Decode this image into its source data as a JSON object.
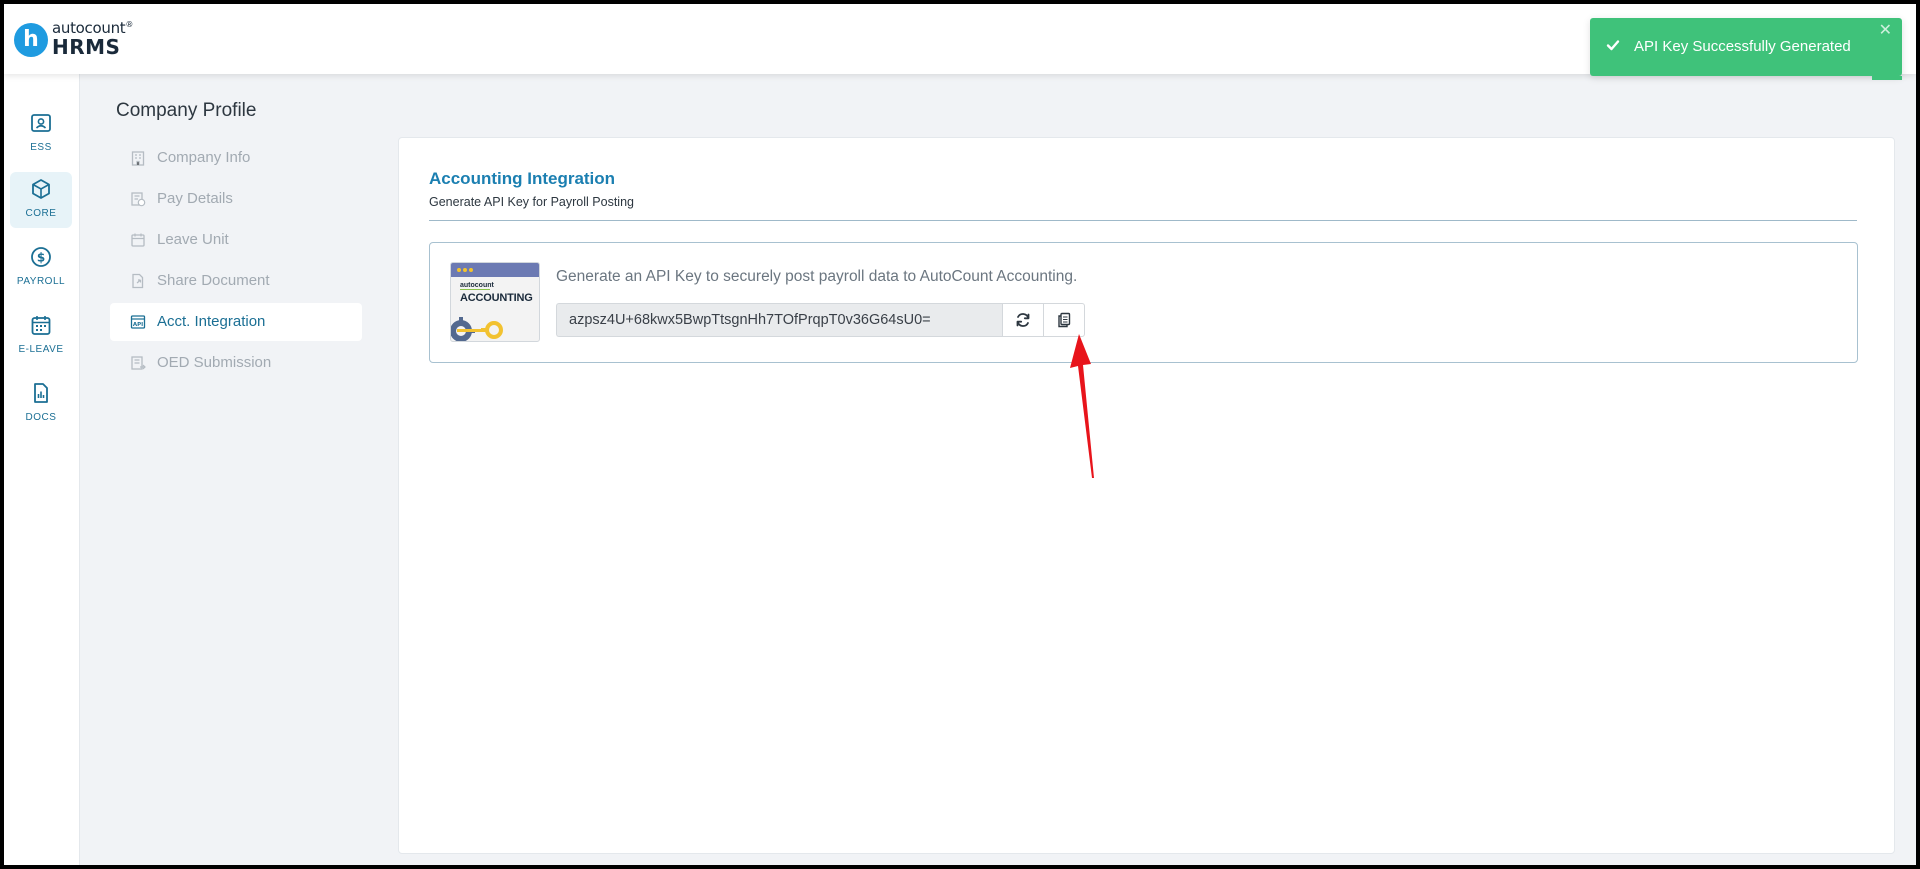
{
  "header": {
    "logo_letter": "h",
    "logo_brand": "autocount",
    "logo_brand_mark": "®",
    "logo_product": "HRMS"
  },
  "toast": {
    "message": "API Key Successfully Generated",
    "close": "✕",
    "color": "#3fc27a"
  },
  "icon_nav": [
    {
      "label": "ESS",
      "icon": "ess-id-card-icon",
      "active": false
    },
    {
      "label": "CORE",
      "icon": "core-cube-icon",
      "active": true
    },
    {
      "label": "PAYROLL",
      "icon": "payroll-dollar-icon",
      "active": false
    },
    {
      "label": "E-LEAVE",
      "icon": "calendar-icon",
      "active": false
    },
    {
      "label": "DOCS",
      "icon": "document-chart-icon",
      "active": false
    }
  ],
  "page": {
    "title": "Company Profile"
  },
  "sub_menu": [
    {
      "label": "Company Info",
      "icon": "building-icon",
      "active": false
    },
    {
      "label": "Pay Details",
      "icon": "pay-details-icon",
      "active": false
    },
    {
      "label": "Leave Unit",
      "icon": "calendar-icon",
      "active": false
    },
    {
      "label": "Share Document",
      "icon": "share-document-icon",
      "active": false
    },
    {
      "label": "Acct. Integration",
      "icon": "api-icon",
      "active": true
    },
    {
      "label": "OED Submission",
      "icon": "submission-icon",
      "active": false
    }
  ],
  "content": {
    "section_title": "Accounting Integration",
    "section_subtitle": "Generate API Key for Payroll Posting",
    "accounting_logo": {
      "brand": "autocount",
      "word": "ACCOUNTING"
    },
    "description": "Generate an API Key to securely post payroll data to AutoCount Accounting.",
    "api_key": "azpsz4U+68kwx5BwpTtsgnHh7TOfPrqpT0v36G64sU0=",
    "refresh_icon": "refresh-icon",
    "copy_icon": "copy-icon"
  },
  "colors": {
    "accent": "#1b7fb1",
    "nav_text": "#1b6f94",
    "annotation_arrow": "#e8141b"
  }
}
